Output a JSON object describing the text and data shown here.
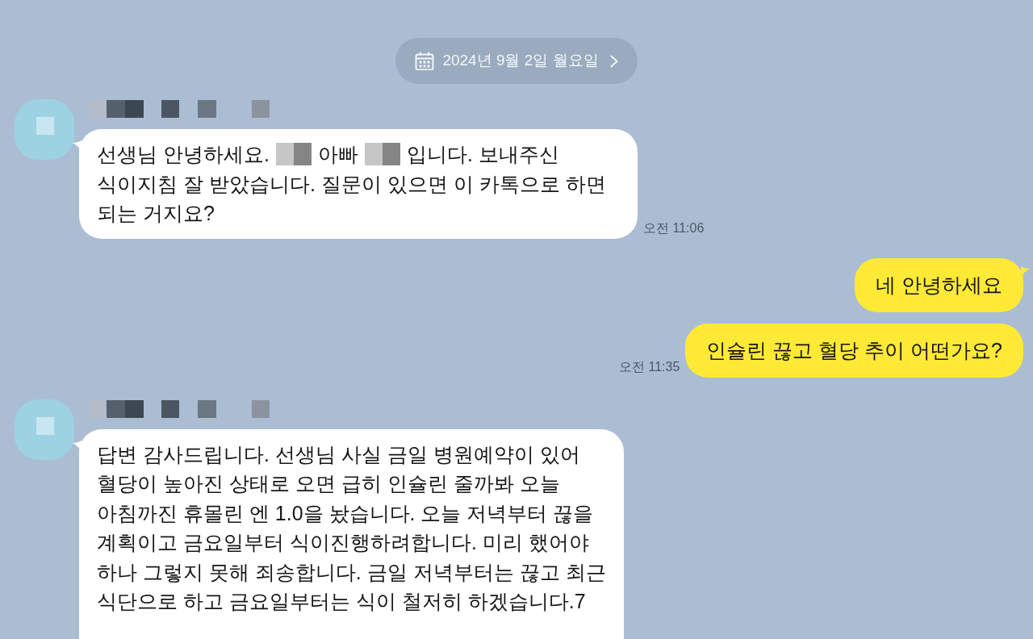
{
  "date_divider": {
    "label": "2024년 9월 2일 월요일"
  },
  "messages": [
    {
      "kind": "incoming",
      "parts": [
        {
          "kind": "text",
          "text": "선생님 안녕하세요."
        },
        {
          "kind": "redacted"
        },
        {
          "kind": "text",
          "text": "아빠"
        },
        {
          "kind": "redacted"
        },
        {
          "kind": "text",
          "text": "입니다. 보내주신"
        },
        {
          "kind": "text",
          "text": "식이지침 잘 받았습니다. 질문이 있으면 이 카톡으로 하면\n되는 거지요?"
        }
      ],
      "time": "오전 11:06"
    },
    {
      "kind": "outgoing",
      "parts": [
        {
          "kind": "text",
          "text": "네 안녕하세요"
        }
      ]
    },
    {
      "kind": "outgoing",
      "parts": [
        {
          "kind": "text",
          "text": "인슐린 끊고 혈당 추이 어떤가요?"
        }
      ],
      "time": "오전 11:35"
    },
    {
      "kind": "incoming",
      "parts": [
        {
          "kind": "text",
          "text": "답변 감사드립니다. 선생님 사실 금일 병원예약이 있어\n혈당이 높아진 상태로 오면 급히 인슐린 줄까봐 오늘\n아침까진 휴몰린 엔 1.0을 놨습니다. 오늘 저녁부터 끊을\n계획이고 금요일부터 식이진행하려합니다. 미리 했어야\n하나 그렇지 못해 죄송합니다. 금일 저녁부터는 끊고 최근\n식단으로 하고 금요일부터는 식이 철저히 하겠습니다.7"
        }
      ]
    }
  ]
}
